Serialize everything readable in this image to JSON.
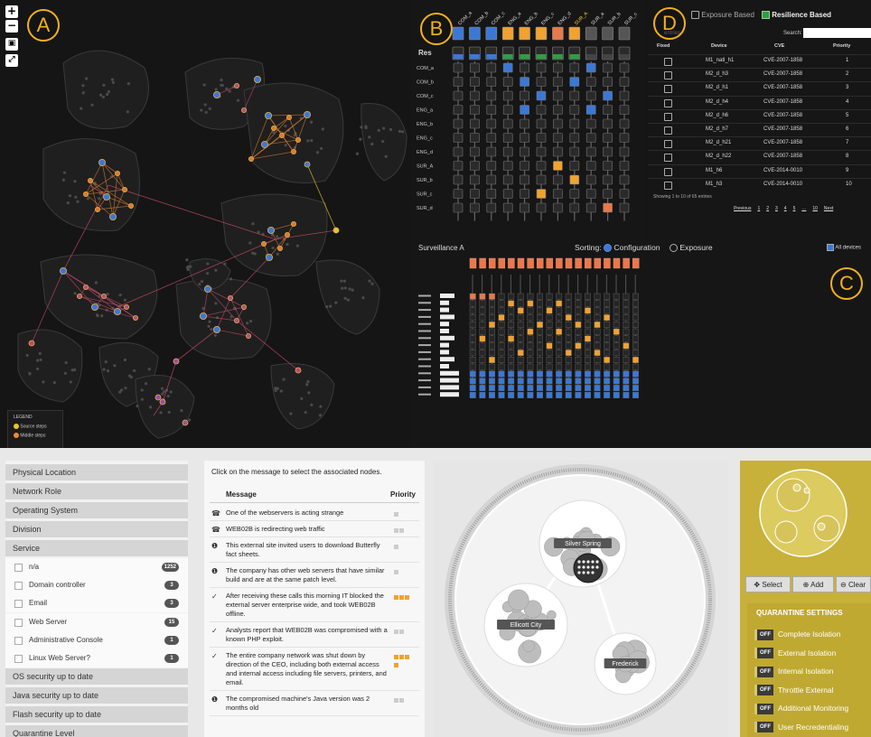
{
  "labels": {
    "a": "A",
    "b": "B",
    "c": "C",
    "d": "D"
  },
  "graph": {
    "zoom_in": "+",
    "zoom_out": "−",
    "legend_title": "LEGEND",
    "legend_items": [
      {
        "label": "Source steps",
        "color": "#e6c42e"
      },
      {
        "label": "Middle steps",
        "color": "#ea8a35"
      }
    ]
  },
  "matrix_b": {
    "res_label": "Res",
    "columns": [
      "COM_a",
      "COM_b",
      "COM_c",
      "ENG_a",
      "ENG_b",
      "ENG_c",
      "ENG_d",
      "SUR_A",
      "SUR_a",
      "SUR_b",
      "SUR_c"
    ],
    "rows": [
      "COM_a",
      "COM_b",
      "COM_c",
      "ENG_a",
      "ENG_b",
      "ENG_c",
      "ENG_d",
      "SUR_A",
      "SUR_b",
      "SUR_c",
      "SUR_d"
    ]
  },
  "table_d": {
    "toggle_exposure": "Exposure Based",
    "toggle_resilience": "Resilience Based",
    "entries_label": "entries",
    "search_label": "Search:",
    "headers": [
      "Fixed",
      "Device",
      "CVE",
      "Priority"
    ],
    "rows": [
      {
        "device": "M1_natl_h1",
        "cve": "CVE-2007-1858",
        "priority": "1"
      },
      {
        "device": "M2_d_h3",
        "cve": "CVE-2007-1858",
        "priority": "2"
      },
      {
        "device": "M2_d_h1",
        "cve": "CVE-2007-1858",
        "priority": "3"
      },
      {
        "device": "M2_d_h4",
        "cve": "CVE-2007-1858",
        "priority": "4"
      },
      {
        "device": "M2_d_h6",
        "cve": "CVE-2007-1858",
        "priority": "5"
      },
      {
        "device": "M2_d_h7",
        "cve": "CVE-2007-1858",
        "priority": "6"
      },
      {
        "device": "M2_d_h21",
        "cve": "CVE-2007-1858",
        "priority": "7"
      },
      {
        "device": "M2_d_h22",
        "cve": "CVE-2007-1858",
        "priority": "8"
      },
      {
        "device": "M1_h6",
        "cve": "CVE-2014-0010",
        "priority": "9"
      },
      {
        "device": "M1_h3",
        "cve": "CVE-2014-0010",
        "priority": "10"
      }
    ],
    "footer": "Showing 1 to 10 of 65 entries",
    "pagination": [
      "Previous",
      "1",
      "2",
      "3",
      "4",
      "5",
      "…",
      "10",
      "Next"
    ]
  },
  "panel_c": {
    "title": "Surveillance A",
    "sorting_label": "Sorting:",
    "opt_configuration": "Configuration",
    "opt_exposure": "Exposure",
    "all_devices": "All devices"
  },
  "filters": {
    "sections_top": [
      "Physical Location",
      "Network Role",
      "Operating System",
      "Division",
      "Service"
    ],
    "service_items": [
      {
        "label": "n/a",
        "count": "1252"
      },
      {
        "label": "Domain controller",
        "count": "3"
      },
      {
        "label": "Email",
        "count": "3"
      },
      {
        "label": "Web Server",
        "count": "15"
      },
      {
        "label": "Administrative Console",
        "count": "1"
      },
      {
        "label": "Linux Web Server?",
        "count": "1"
      }
    ],
    "sections_bottom": [
      "OS security up to date",
      "Java security up to date",
      "Flash security up to date",
      "Quarantine Level"
    ]
  },
  "messages": {
    "instruction": "Click on the message to select the associated nodes.",
    "col_message": "Message",
    "col_priority": "Priority",
    "rows": [
      {
        "icon": "phone-icon",
        "text": "One of the webservers is acting strange",
        "priority": 1
      },
      {
        "icon": "phone-icon",
        "text": "WEB02B is redirecting web traffic",
        "priority": 2
      },
      {
        "icon": "info-icon",
        "text": "This external site invited users to download Butterfly fact sheets.",
        "priority": 1
      },
      {
        "icon": "info-icon",
        "text": "The company has other web servers that have similar build and are at the same patch level.",
        "priority": 1
      },
      {
        "icon": "check-icon",
        "text": "After receiving these calls this morning IT blocked the external server enterprise wide, and took WEB02B offline.",
        "priority": 3
      },
      {
        "icon": "check-icon",
        "text": "Analysts report that WEB02B was compromised with a known PHP exploit.",
        "priority": 2
      },
      {
        "icon": "check-icon",
        "text": "The entire company network was shut down by direction of the CEO, including both external access and internal access including file servers, printers, and email.",
        "priority": 4
      },
      {
        "icon": "info-icon",
        "text": "The compromised machine's Java version was 2 months old",
        "priority": 2
      }
    ]
  },
  "bubbles": {
    "clusters": [
      "Silver Spring",
      "Ellicott City",
      "Frederick"
    ]
  },
  "quarantine": {
    "buttons": {
      "select": "Select",
      "add": "Add",
      "clear": "Clear"
    },
    "title": "QUARANTINE SETTINGS",
    "off_label": "OFF",
    "settings": [
      "Complete Isolation",
      "External Isolation",
      "Internal Isolation",
      "Throttle External",
      "Additional Monitoring",
      "User Recredentialing"
    ]
  },
  "colors": {
    "orange": "#f1a230",
    "blue": "#3b78d6",
    "green": "#2f9e44",
    "gold": "#c7b13a"
  }
}
